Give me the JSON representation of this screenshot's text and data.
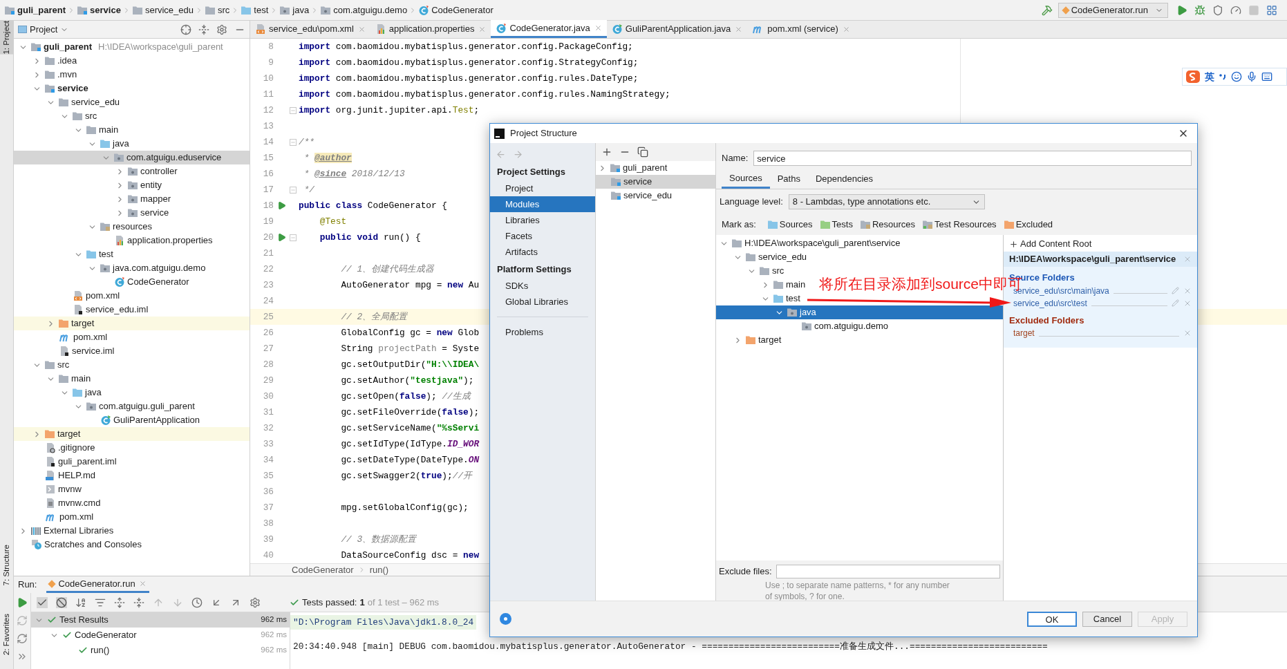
{
  "breadcrumb": [
    {
      "label": "guli_parent",
      "kind": "module"
    },
    {
      "label": "service",
      "kind": "module"
    },
    {
      "label": "service_edu",
      "kind": "folder"
    },
    {
      "label": "src",
      "kind": "folder"
    },
    {
      "label": "test",
      "kind": "source-folder"
    },
    {
      "label": "java",
      "kind": "package"
    },
    {
      "label": "com.atguigu.demo",
      "kind": "package"
    },
    {
      "label": "CodeGenerator",
      "kind": "class"
    }
  ],
  "run_config": {
    "label": "CodeGenerator.run"
  },
  "tool_stripe": [
    {
      "label": "1: Project",
      "selected": true
    },
    {
      "label": "7: Structure",
      "selected": false
    },
    {
      "label": "2: Favorites",
      "selected": false
    }
  ],
  "project_panel": {
    "title": "Project"
  },
  "project_tree": [
    {
      "label": "guli_parent",
      "kind": "module",
      "hint": "H:\\IDEA\\workspace\\guli_parent",
      "expanded": true,
      "selected": false,
      "children": [
        {
          "label": ".idea",
          "kind": "folder",
          "expanded": false,
          "selected": false
        },
        {
          "label": ".mvn",
          "kind": "folder",
          "expanded": false,
          "selected": false
        },
        {
          "label": "service",
          "kind": "module",
          "expanded": true,
          "selected": false,
          "children": [
            {
              "label": "service_edu",
              "kind": "folder",
              "expanded": true,
              "selected": false,
              "children": [
                {
                  "label": "src",
                  "kind": "folder",
                  "expanded": true,
                  "selected": false,
                  "children": [
                    {
                      "label": "main",
                      "kind": "folder",
                      "expanded": true,
                      "selected": false,
                      "children": [
                        {
                          "label": "java",
                          "kind": "source-folder",
                          "expanded": true,
                          "selected": false,
                          "children": [
                            {
                              "label": "com.atguigu.eduservice",
                              "kind": "package",
                              "expanded": true,
                              "selected": true,
                              "children": [
                                {
                                  "label": "controller",
                                  "kind": "package",
                                  "expanded": false,
                                  "selected": false
                                },
                                {
                                  "label": "entity",
                                  "kind": "package",
                                  "expanded": false,
                                  "selected": false
                                },
                                {
                                  "label": "mapper",
                                  "kind": "package",
                                  "expanded": false,
                                  "selected": false
                                },
                                {
                                  "label": "service",
                                  "kind": "package",
                                  "expanded": false,
                                  "selected": false
                                }
                              ]
                            }
                          ]
                        },
                        {
                          "label": "resources",
                          "kind": "resources-folder",
                          "expanded": true,
                          "selected": false,
                          "children": [
                            {
                              "label": "application.properties",
                              "kind": "properties",
                              "selected": false
                            }
                          ]
                        }
                      ]
                    },
                    {
                      "label": "test",
                      "kind": "source-folder",
                      "expanded": true,
                      "selected": false,
                      "children": [
                        {
                          "label": "java.com.atguigu.demo",
                          "kind": "package",
                          "expanded": true,
                          "selected": false,
                          "children": [
                            {
                              "label": "CodeGenerator",
                              "kind": "class",
                              "selected": false
                            }
                          ]
                        }
                      ]
                    }
                  ]
                },
                {
                  "label": "pom.xml",
                  "kind": "xml",
                  "selected": false
                },
                {
                  "label": "service_edu.iml",
                  "kind": "iml",
                  "selected": false
                }
              ]
            },
            {
              "label": "target",
              "kind": "excluded",
              "expanded": false,
              "selected": false
            },
            {
              "label": "pom.xml",
              "kind": "maven",
              "selected": false
            },
            {
              "label": "service.iml",
              "kind": "iml",
              "selected": false
            }
          ]
        },
        {
          "label": "src",
          "kind": "folder",
          "expanded": true,
          "selected": false,
          "children": [
            {
              "label": "main",
              "kind": "folder",
              "expanded": true,
              "selected": false,
              "children": [
                {
                  "label": "java",
                  "kind": "source-folder",
                  "expanded": true,
                  "selected": false,
                  "children": [
                    {
                      "label": "com.atguigu.guli_parent",
                      "kind": "package",
                      "expanded": true,
                      "selected": false,
                      "children": [
                        {
                          "label": "GuliParentApplication",
                          "kind": "app-class",
                          "selected": false
                        }
                      ]
                    }
                  ]
                }
              ]
            }
          ]
        },
        {
          "label": "target",
          "kind": "excluded",
          "expanded": false,
          "selected": false
        },
        {
          "label": ".gitignore",
          "kind": "gitignore",
          "selected": false
        },
        {
          "label": "guli_parent.iml",
          "kind": "iml",
          "selected": false
        },
        {
          "label": "HELP.md",
          "kind": "md",
          "selected": false
        },
        {
          "label": "mvnw",
          "kind": "script",
          "selected": false
        },
        {
          "label": "mvnw.cmd",
          "kind": "cmd",
          "selected": false
        },
        {
          "label": "pom.xml",
          "kind": "maven",
          "selected": false
        }
      ]
    },
    {
      "label": "External Libraries",
      "kind": "libraries",
      "expanded": false,
      "selected": false
    },
    {
      "label": "Scratches and Consoles",
      "kind": "scratches",
      "selected": false
    }
  ],
  "editor_tabs": [
    {
      "label": "service_edu\\pom.xml",
      "kind": "xml",
      "selected": false
    },
    {
      "label": "application.properties",
      "kind": "properties",
      "selected": false
    },
    {
      "label": "CodeGenerator.java",
      "kind": "class",
      "selected": true
    },
    {
      "label": "GuliParentApplication.java",
      "kind": "app-class",
      "selected": false
    },
    {
      "label": "pom.xml (service)",
      "kind": "maven",
      "selected": false
    }
  ],
  "code_lines": [
    {
      "number": "8",
      "run_marker": false,
      "fold": false,
      "current": false,
      "tokens": [
        {
          "kind": "kw",
          "text": "import"
        },
        {
          "kind": "plain",
          "text": " com.baomidou.mybatisplus.generator.config.PackageConfig;"
        }
      ]
    },
    {
      "number": "9",
      "run_marker": false,
      "fold": false,
      "current": false,
      "tokens": [
        {
          "kind": "kw",
          "text": "import"
        },
        {
          "kind": "plain",
          "text": " com.baomidou.mybatisplus.generator.config.StrategyConfig;"
        }
      ]
    },
    {
      "number": "10",
      "run_marker": false,
      "fold": false,
      "current": false,
      "tokens": [
        {
          "kind": "kw",
          "text": "import"
        },
        {
          "kind": "plain",
          "text": " com.baomidou.mybatisplus.generator.config.rules.DateType;"
        }
      ]
    },
    {
      "number": "11",
      "run_marker": false,
      "fold": false,
      "current": false,
      "tokens": [
        {
          "kind": "kw",
          "text": "import"
        },
        {
          "kind": "plain",
          "text": " com.baomidou.mybatisplus.generator.config.rules.NamingStrategy;"
        }
      ]
    },
    {
      "number": "12",
      "run_marker": false,
      "fold": true,
      "current": false,
      "tokens": [
        {
          "kind": "kw",
          "text": "import"
        },
        {
          "kind": "plain",
          "text": " org.junit.jupiter.api."
        },
        {
          "kind": "annotation",
          "text": "Test"
        },
        {
          "kind": "plain",
          "text": ";"
        }
      ]
    },
    {
      "number": "13",
      "run_marker": false,
      "fold": false,
      "current": false
    },
    {
      "number": "14",
      "run_marker": false,
      "fold": true,
      "current": false,
      "tokens": [
        {
          "kind": "doc",
          "text": "/**"
        }
      ]
    },
    {
      "number": "15",
      "run_marker": false,
      "fold": false,
      "current": false,
      "tokens": [
        {
          "kind": "doc",
          "text": " * "
        },
        {
          "kind": "doctag-hl",
          "text": "@author"
        }
      ]
    },
    {
      "number": "16",
      "run_marker": false,
      "fold": false,
      "current": false,
      "tokens": [
        {
          "kind": "doc",
          "text": " * "
        },
        {
          "kind": "doctag",
          "text": "@since"
        },
        {
          "kind": "doc",
          "text": " 2018/12/13"
        }
      ]
    },
    {
      "number": "17",
      "run_marker": false,
      "fold": true,
      "current": false,
      "tokens": [
        {
          "kind": "doc",
          "text": " */"
        }
      ]
    },
    {
      "number": "18",
      "run_marker": true,
      "fold": false,
      "current": false,
      "tokens": [
        {
          "kind": "kw",
          "text": "public class"
        },
        {
          "kind": "plain",
          "text": " CodeGenerator {"
        }
      ]
    },
    {
      "number": "19",
      "run_marker": false,
      "fold": false,
      "current": false,
      "tokens": [
        {
          "kind": "annotation",
          "text": "    @Test"
        }
      ]
    },
    {
      "number": "20",
      "run_marker": true,
      "fold": true,
      "current": false,
      "tokens": [
        {
          "kind": "kw",
          "text": "    public void"
        },
        {
          "kind": "plain",
          "text": " run() {"
        }
      ]
    },
    {
      "number": "21",
      "run_marker": false,
      "fold": false,
      "current": false
    },
    {
      "number": "22",
      "run_marker": false,
      "fold": false,
      "current": false,
      "tokens": [
        {
          "kind": "comment",
          "text": "        // 1、创建代码生成器"
        }
      ]
    },
    {
      "number": "23",
      "run_marker": false,
      "fold": false,
      "current": false,
      "tokens": [
        {
          "kind": "plain",
          "text": "        AutoGenerator mpg = "
        },
        {
          "kind": "kw",
          "text": "new"
        },
        {
          "kind": "plain",
          "text": " Au"
        }
      ]
    },
    {
      "number": "24",
      "run_marker": false,
      "fold": false,
      "current": false
    },
    {
      "number": "25",
      "run_marker": false,
      "fold": false,
      "current": true,
      "tokens": [
        {
          "kind": "comment",
          "text": "        // 2、全局配置"
        }
      ]
    },
    {
      "number": "26",
      "run_marker": false,
      "fold": false,
      "current": false,
      "tokens": [
        {
          "kind": "plain",
          "text": "        GlobalConfig gc = "
        },
        {
          "kind": "kw",
          "text": "new"
        },
        {
          "kind": "plain",
          "text": " Glob"
        }
      ]
    },
    {
      "number": "27",
      "run_marker": false,
      "fold": false,
      "current": false,
      "tokens": [
        {
          "kind": "plain",
          "text": "        String "
        },
        {
          "kind": "unused",
          "text": "projectPath"
        },
        {
          "kind": "plain",
          "text": " = Syste"
        }
      ]
    },
    {
      "number": "28",
      "run_marker": false,
      "fold": false,
      "current": false,
      "tokens": [
        {
          "kind": "plain",
          "text": "        gc.setOutputDir("
        },
        {
          "kind": "str",
          "text": "\"H:\\\\IDEA\\"
        }
      ]
    },
    {
      "number": "29",
      "run_marker": false,
      "fold": false,
      "current": false,
      "tokens": [
        {
          "kind": "plain",
          "text": "        gc.setAuthor("
        },
        {
          "kind": "str",
          "text": "\"testjava\""
        },
        {
          "kind": "plain",
          "text": ");"
        }
      ]
    },
    {
      "number": "30",
      "run_marker": false,
      "fold": false,
      "current": false,
      "tokens": [
        {
          "kind": "plain",
          "text": "        gc.setOpen("
        },
        {
          "kind": "kw",
          "text": "false"
        },
        {
          "kind": "plain",
          "text": "); "
        },
        {
          "kind": "comment",
          "text": "//生成"
        }
      ]
    },
    {
      "number": "31",
      "run_marker": false,
      "fold": false,
      "current": false,
      "tokens": [
        {
          "kind": "plain",
          "text": "        gc.setFileOverride("
        },
        {
          "kind": "kw",
          "text": "false"
        },
        {
          "kind": "plain",
          "text": ");"
        }
      ]
    },
    {
      "number": "32",
      "run_marker": false,
      "fold": false,
      "current": false,
      "tokens": [
        {
          "kind": "plain",
          "text": "        gc.setServiceName("
        },
        {
          "kind": "str",
          "text": "\"%sServi"
        }
      ]
    },
    {
      "number": "33",
      "run_marker": false,
      "fold": false,
      "current": false,
      "tokens": [
        {
          "kind": "plain",
          "text": "        gc.setIdType(IdType."
        },
        {
          "kind": "field",
          "text": "ID_WOR"
        }
      ]
    },
    {
      "number": "34",
      "run_marker": false,
      "fold": false,
      "current": false,
      "tokens": [
        {
          "kind": "plain",
          "text": "        gc.setDateType(DateType."
        },
        {
          "kind": "field",
          "text": "ON"
        }
      ]
    },
    {
      "number": "35",
      "run_marker": false,
      "fold": false,
      "current": false,
      "tokens": [
        {
          "kind": "plain",
          "text": "        gc.setSwagger2("
        },
        {
          "kind": "kw",
          "text": "true"
        },
        {
          "kind": "plain",
          "text": ");"
        },
        {
          "kind": "comment",
          "text": "//开"
        }
      ]
    },
    {
      "number": "36",
      "run_marker": false,
      "fold": false,
      "current": false
    },
    {
      "number": "37",
      "run_marker": false,
      "fold": false,
      "current": false,
      "tokens": [
        {
          "kind": "plain",
          "text": "        mpg.setGlobalConfig(gc);"
        }
      ]
    },
    {
      "number": "38",
      "run_marker": false,
      "fold": false,
      "current": false
    },
    {
      "number": "39",
      "run_marker": false,
      "fold": false,
      "current": false,
      "tokens": [
        {
          "kind": "comment",
          "text": "        // 3、数据源配置"
        }
      ]
    },
    {
      "number": "40",
      "run_marker": false,
      "fold": false,
      "current": false,
      "tokens": [
        {
          "kind": "plain",
          "text": "        DataSourceConfig dsc = "
        },
        {
          "kind": "kw",
          "text": "new"
        }
      ]
    }
  ],
  "editor_breadcrumb": [
    "CodeGenerator",
    "run()"
  ],
  "ime_bar": {
    "label": "英"
  },
  "run_panel": {
    "label": "Run:",
    "tab": "CodeGenerator.run",
    "status": {
      "label": "Tests passed:",
      "count": "1",
      "detail": "of 1 test – 962 ms"
    },
    "tests": [
      {
        "label": "Test Results",
        "time": "962 ms",
        "expanded": true,
        "selected": true,
        "children": [
          {
            "label": "CodeGenerator",
            "time": "962 ms",
            "expanded": true,
            "selected": false,
            "children": [
              {
                "label": "run()",
                "time": "962 ms",
                "selected": false
              }
            ]
          }
        ]
      }
    ],
    "console": [
      {
        "kind": "command",
        "text": "\"D:\\Program Files\\Java\\jdk1.8.0_24"
      },
      {
        "kind": "log",
        "text": "20:34:40.948 [main] DEBUG com.baomidou.mybatisplus.generator.AutoGenerator - ==========================准备生成文件...=========================="
      }
    ]
  },
  "dialog": {
    "title": "Project Structure",
    "nav_sections": [
      {
        "title": "Project Settings",
        "items": [
          {
            "label": "Project",
            "selected": false
          },
          {
            "label": "Modules",
            "selected": true
          },
          {
            "label": "Libraries",
            "selected": false
          },
          {
            "label": "Facets",
            "selected": false
          },
          {
            "label": "Artifacts",
            "selected": false
          }
        ]
      },
      {
        "title": "Platform Settings",
        "items": [
          {
            "label": "SDKs",
            "selected": false
          },
          {
            "label": "Global Libraries",
            "selected": false
          }
        ]
      }
    ],
    "nav_extra": [
      {
        "label": "Problems",
        "selected": false
      }
    ],
    "modules": [
      {
        "label": "guli_parent",
        "expanded": false,
        "selected": false
      },
      {
        "label": "service",
        "selected": true
      },
      {
        "label": "service_edu",
        "selected": false
      }
    ],
    "name_label": "Name:",
    "name_value": "service",
    "tabs": [
      {
        "label": "Sources",
        "selected": true
      },
      {
        "label": "Paths",
        "selected": false
      },
      {
        "label": "Dependencies",
        "selected": false
      }
    ],
    "language_label": "Language level:",
    "language_value": "8 - Lambdas, type annotations etc.",
    "mark_label": "Mark as:",
    "mark_as": [
      {
        "label": "Sources",
        "kind": "source-folder"
      },
      {
        "label": "Tests",
        "kind": "test-folder"
      },
      {
        "label": "Resources",
        "kind": "resources-folder"
      },
      {
        "label": "Test Resources",
        "kind": "test-resources-folder"
      },
      {
        "label": "Excluded",
        "kind": "excluded"
      }
    ],
    "tree": [
      {
        "label": "H:\\IDEA\\workspace\\guli_parent\\service",
        "kind": "folder",
        "expanded": true,
        "selected": false,
        "children": [
          {
            "label": "service_edu",
            "kind": "folder",
            "expanded": true,
            "selected": false,
            "children": [
              {
                "label": "src",
                "kind": "folder",
                "expanded": true,
                "selected": false,
                "children": [
                  {
                    "label": "main",
                    "kind": "folder",
                    "expanded": false,
                    "selected": false
                  },
                  {
                    "label": "test",
                    "kind": "source-folder",
                    "expanded": true,
                    "selected": false,
                    "children": [
                      {
                        "label": "java",
                        "kind": "package",
                        "expanded": true,
                        "selected": true,
                        "children": [
                          {
                            "label": "com.atguigu.demo",
                            "kind": "package",
                            "selected": false
                          }
                        ]
                      }
                    ]
                  }
                ]
              }
            ]
          },
          {
            "label": "target",
            "kind": "excluded",
            "expanded": false,
            "selected": false
          }
        ]
      }
    ],
    "exclude_label": "Exclude files:",
    "exclude_hint": "Use ; to separate name patterns, * for any number of symbols, ? for one.",
    "roots": {
      "add_label": "Add Content Root",
      "root": "H:\\IDEA\\workspace\\guli_parent\\service",
      "groups": [
        {
          "kind": "source",
          "title": "Source Folders",
          "items": [
            "service_edu\\src\\main\\java",
            "service_edu\\src\\test"
          ]
        },
        {
          "kind": "excluded",
          "title": "Excluded Folders",
          "items": [
            "target"
          ]
        }
      ]
    },
    "buttons": [
      {
        "label": "OK",
        "kind": "default",
        "disabled": false
      },
      {
        "label": "Cancel",
        "kind": "normal",
        "disabled": false
      },
      {
        "label": "Apply",
        "kind": "normal",
        "disabled": true
      }
    ]
  },
  "annotation": {
    "text": "将所在目录添加到source中即可"
  }
}
